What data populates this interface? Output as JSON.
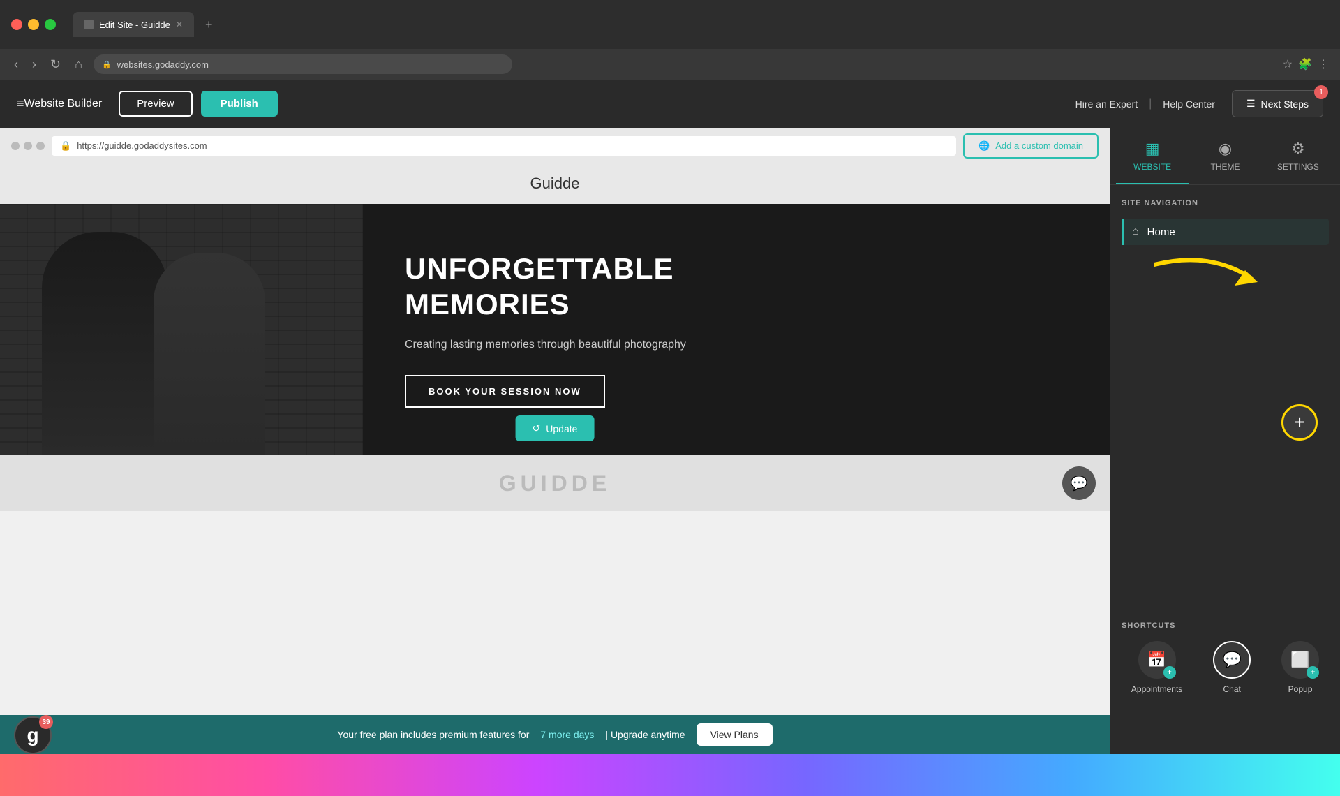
{
  "browser": {
    "tab_title": "Edit Site - Guidde",
    "tab_add": "+",
    "url": "websites.godaddy.com",
    "nav_back": "‹",
    "nav_forward": "›",
    "nav_refresh": "↻",
    "nav_home": "⌂"
  },
  "header": {
    "website_builder": "Website Builder",
    "preview_label": "Preview",
    "publish_label": "Publish",
    "hire_expert": "Hire an Expert",
    "help_center": "Help Center",
    "next_steps": "Next Steps",
    "notification_count": "1"
  },
  "preview": {
    "url": "https://guidde.godaddysites.com",
    "add_domain": "Add a custom domain",
    "site_name": "Guidde",
    "hero_title_line1": "UNFORGETTABLE",
    "hero_title_line2": "MEMORIES",
    "hero_subtitle": "Creating lasting memories through beautiful photography",
    "book_btn": "BOOK YOUR SESSION NOW",
    "update_btn": "Update",
    "guidde_text": "GUIDDE"
  },
  "banner": {
    "text": "Your free plan includes premium features for",
    "days_link": "7 more days",
    "separator": "| Upgrade anytime",
    "view_plans": "View Plans",
    "godaddy_badge": "g",
    "godaddy_notif": "39"
  },
  "right_panel": {
    "tabs": [
      {
        "id": "website",
        "label": "WEBSITE",
        "icon": "▦"
      },
      {
        "id": "theme",
        "label": "THEME",
        "icon": "◉"
      },
      {
        "id": "settings",
        "label": "SETTINGS",
        "icon": "⚙"
      }
    ],
    "site_navigation": "SITE NAVIGATION",
    "nav_items": [
      {
        "label": "Home",
        "icon": "⌂"
      }
    ],
    "shortcuts": "SHORTCUTS",
    "shortcut_items": [
      {
        "label": "Appointments",
        "icon": "📅",
        "badge": "+"
      },
      {
        "label": "Chat",
        "icon": "💬",
        "active": true
      },
      {
        "label": "Popup",
        "icon": "⬜",
        "badge": "+"
      }
    ]
  },
  "annotation": {
    "add_btn": "+"
  }
}
